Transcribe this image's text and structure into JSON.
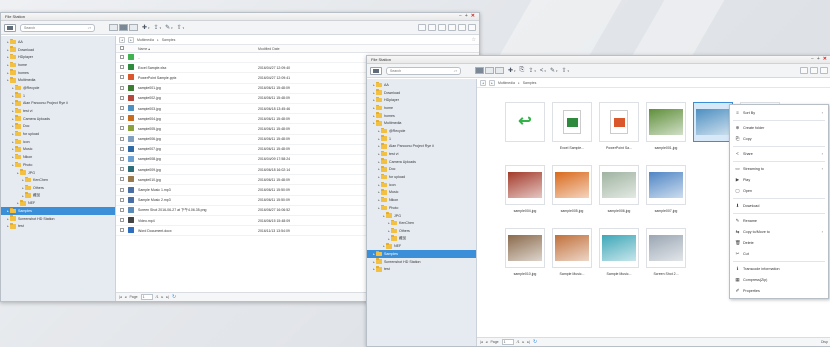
{
  "colors": {
    "accent": "#3b8ed8",
    "folder": "#f2c043",
    "close": "#d32020"
  },
  "app_title": "File Station",
  "window_controls": [
    "−",
    "+",
    "✕"
  ],
  "search_placeholder": "Search",
  "breadcrumb": [
    "Multimedia",
    "Samples"
  ],
  "tree": [
    {
      "label": "AA",
      "depth": 1
    },
    {
      "label": "Download",
      "depth": 1
    },
    {
      "label": "HDplayer",
      "depth": 1
    },
    {
      "label": "home",
      "depth": 1
    },
    {
      "label": "homes",
      "depth": 1
    },
    {
      "label": "Multimedia",
      "depth": 1
    },
    {
      "label": "@Recycle",
      "depth": 2
    },
    {
      "label": "1",
      "depth": 2
    },
    {
      "label": "Alan Panoonu Project Rye ii",
      "depth": 2
    },
    {
      "label": "test vi",
      "depth": 2
    },
    {
      "label": "Camera Uploads",
      "depth": 2
    },
    {
      "label": "Doc",
      "depth": 2
    },
    {
      "label": "for upload",
      "depth": 2
    },
    {
      "label": "icon",
      "depth": 2
    },
    {
      "label": "Music",
      "depth": 2
    },
    {
      "label": "Nikon",
      "depth": 2
    },
    {
      "label": "Photo",
      "depth": 2
    },
    {
      "label": "JPG",
      "depth": 3
    },
    {
      "label": "KenChen",
      "depth": 4
    },
    {
      "label": "Others",
      "depth": 4
    },
    {
      "label": "藏品",
      "depth": 4
    },
    {
      "label": "NEF",
      "depth": 3
    },
    {
      "label": "Samples",
      "depth": 1,
      "selected": true
    },
    {
      "label": "Screenshot HD Station",
      "depth": 1
    },
    {
      "label": "test",
      "depth": 1
    }
  ],
  "list_headers": {
    "name": "Name ▴",
    "modified": "Modified Date"
  },
  "files": [
    {
      "name": "..",
      "date": "",
      "color": "#3fb34f"
    },
    {
      "name": "Excel Sample.xlsx",
      "date": "2016/04/27 12:09:40",
      "color": "#2e8b3e"
    },
    {
      "name": "PowerPoint Sample.pptx",
      "date": "2016/04/27 12:09:41",
      "color": "#d9572b"
    },
    {
      "name": "sample001.jpg",
      "date": "2016/06/11 15:48:09",
      "color": "#3e7c34"
    },
    {
      "name": "sample002.jpg",
      "date": "2016/06/11 15:48:09",
      "color": "#b5483a"
    },
    {
      "name": "sample003.jpg",
      "date": "2016/06/18 13:45:46",
      "color": "#4d8fc1"
    },
    {
      "name": "sample004.jpg",
      "date": "2016/06/11 15:48:09",
      "color": "#c96a1c"
    },
    {
      "name": "sample005.jpg",
      "date": "2016/06/11 15:48:09",
      "color": "#8aa23b"
    },
    {
      "name": "sample006.jpg",
      "date": "2016/06/11 15:48:09",
      "color": "#7f9fc0"
    },
    {
      "name": "sample007.jpg",
      "date": "2016/06/11 15:48:09",
      "color": "#2d6aa6"
    },
    {
      "name": "sample008.jpg",
      "date": "2016/04/09 17:58:24",
      "color": "#6aa0d1"
    },
    {
      "name": "sample009.jpg",
      "date": "2016/06/18 16:02:14",
      "color": "#2c6f7a"
    },
    {
      "name": "sample010.jpg",
      "date": "2016/06/11 15:48:09",
      "color": "#9a7a4c"
    },
    {
      "name": "Sample Music 1.mp3",
      "date": "2016/06/11 15:50:09",
      "color": "#4a6fa5"
    },
    {
      "name": "Sample Music 2.mp3",
      "date": "2016/06/11 15:50:09",
      "color": "#4a6fa5"
    },
    {
      "name": "Screen Shot 2016-06-27 at 下午4.06.35.png",
      "date": "2016/06/27 16:06:52",
      "color": "#5a8ab8"
    },
    {
      "name": "Video.mp4",
      "date": "2016/06/15 15:48:09",
      "color": "#444444"
    },
    {
      "name": "Word Document.docx",
      "date": "2016/11/13 13:54:09",
      "color": "#2f6dbf"
    }
  ],
  "pager": {
    "label": "Page",
    "value": "1",
    "of": "/1"
  },
  "status_right": "Disp",
  "tiles": [
    {
      "caption": "",
      "color": "#35b24a",
      "kind": "up"
    },
    {
      "caption": "Excel Sample...",
      "color": "#2e8b3e",
      "kind": "doc"
    },
    {
      "caption": "PowerPoint Sa...",
      "color": "#d9572b",
      "kind": "doc"
    },
    {
      "caption": "sample001.jpg",
      "color": "#5f8f3a",
      "kind": "img"
    },
    {
      "caption": "",
      "color": "#4d8fc1",
      "kind": "img",
      "selected": true
    },
    {
      "caption": "",
      "color": "#d8902a",
      "kind": "img"
    },
    {
      "caption": "sample004.jpg",
      "color": "#a33a2a",
      "kind": "img"
    },
    {
      "caption": "sample005.jpg",
      "color": "#d96a1c",
      "kind": "img"
    },
    {
      "caption": "sample006.jpg",
      "color": "#9fb3a0",
      "kind": "img"
    },
    {
      "caption": "sample007.jpg",
      "color": "#4f86c4",
      "kind": "img"
    },
    {
      "caption": "sample010.jpg",
      "color": "#8a6a4c",
      "kind": "img"
    },
    {
      "caption": "Sample Music...",
      "color": "#c0703a",
      "kind": "img"
    },
    {
      "caption": "Sample Music...",
      "color": "#3da7b8",
      "kind": "img"
    },
    {
      "caption": "Screen Shot 2...",
      "color": "#9aa6b3",
      "kind": "img"
    }
  ],
  "context_menu": [
    {
      "label": "Sort By",
      "icon": "≡",
      "sub": true,
      "sep_after": true
    },
    {
      "label": "Create folder",
      "icon": "⊕"
    },
    {
      "label": "Copy",
      "icon": "⎘",
      "sep_after": true
    },
    {
      "label": "Share",
      "icon": "<",
      "sub": true,
      "sep_after": true
    },
    {
      "label": "Streaming to",
      "icon": "▭",
      "sub": true
    },
    {
      "label": "Play",
      "icon": "▶"
    },
    {
      "label": "Open",
      "icon": "▢",
      "sep_after": true
    },
    {
      "label": "Download",
      "icon": "⬇",
      "sep_after": true
    },
    {
      "label": "Rename",
      "icon": "✎"
    },
    {
      "label": "Copy to/Move to",
      "icon": "⇆",
      "sub": true
    },
    {
      "label": "Delete",
      "icon": "🗑"
    },
    {
      "label": "Cut",
      "icon": "✂",
      "sep_after": true
    },
    {
      "label": "Transcode information",
      "icon": "ℹ"
    },
    {
      "label": "Compress(Zip)",
      "icon": "▦"
    },
    {
      "label": "Properties",
      "icon": "✐"
    }
  ]
}
